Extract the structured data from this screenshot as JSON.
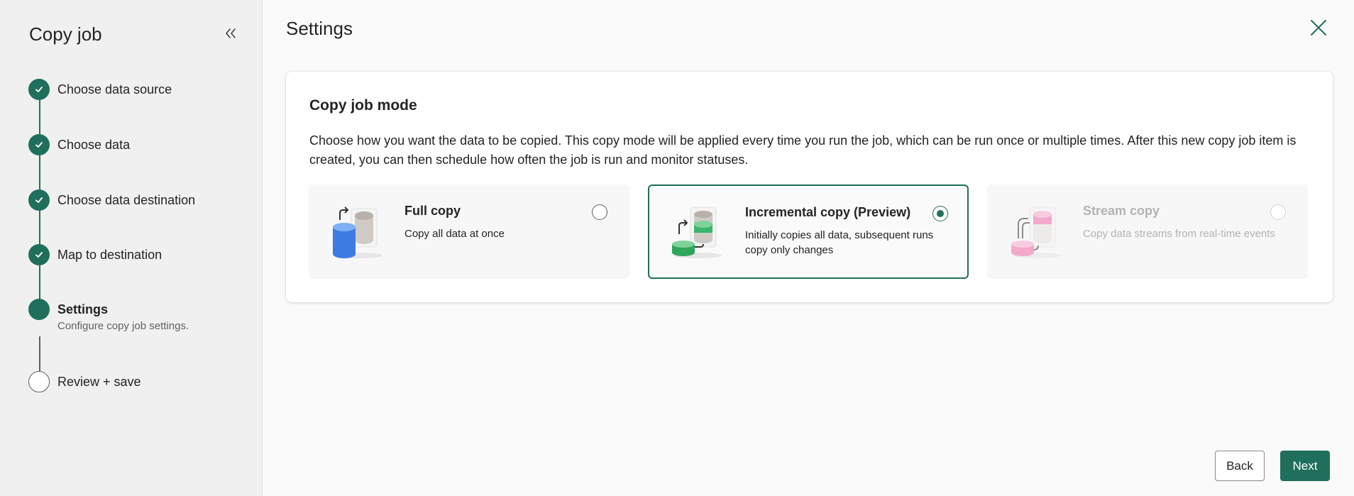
{
  "sidebar": {
    "title": "Copy job",
    "steps": [
      {
        "label": "Choose data source",
        "status": "done"
      },
      {
        "label": "Choose data",
        "status": "done"
      },
      {
        "label": "Choose data destination",
        "status": "done"
      },
      {
        "label": "Map to destination",
        "status": "done"
      },
      {
        "label": "Settings",
        "sublabel": "Configure copy job settings.",
        "status": "current"
      },
      {
        "label": "Review + save",
        "status": "todo"
      }
    ]
  },
  "main": {
    "title": "Settings",
    "card": {
      "title": "Copy job mode",
      "description": "Choose how you want the data to be copied. This copy mode will be applied every time you run the job, which can be run once or multiple times. After this new copy job item is created, you can then schedule how often the job is run and monitor statuses.",
      "options": [
        {
          "title": "Full copy",
          "description": "Copy all data at once",
          "selected": false,
          "disabled": false
        },
        {
          "title": "Incremental copy (Preview)",
          "description": "Initially copies all data, subsequent runs copy only changes",
          "selected": true,
          "disabled": false
        },
        {
          "title": "Stream copy",
          "description": "Copy data streams from real-time events",
          "selected": false,
          "disabled": true
        }
      ]
    },
    "buttons": {
      "back": "Back",
      "next": "Next"
    }
  },
  "colors": {
    "accent": "#1f6f5c",
    "sidebar_bg": "#f0f0f0"
  }
}
